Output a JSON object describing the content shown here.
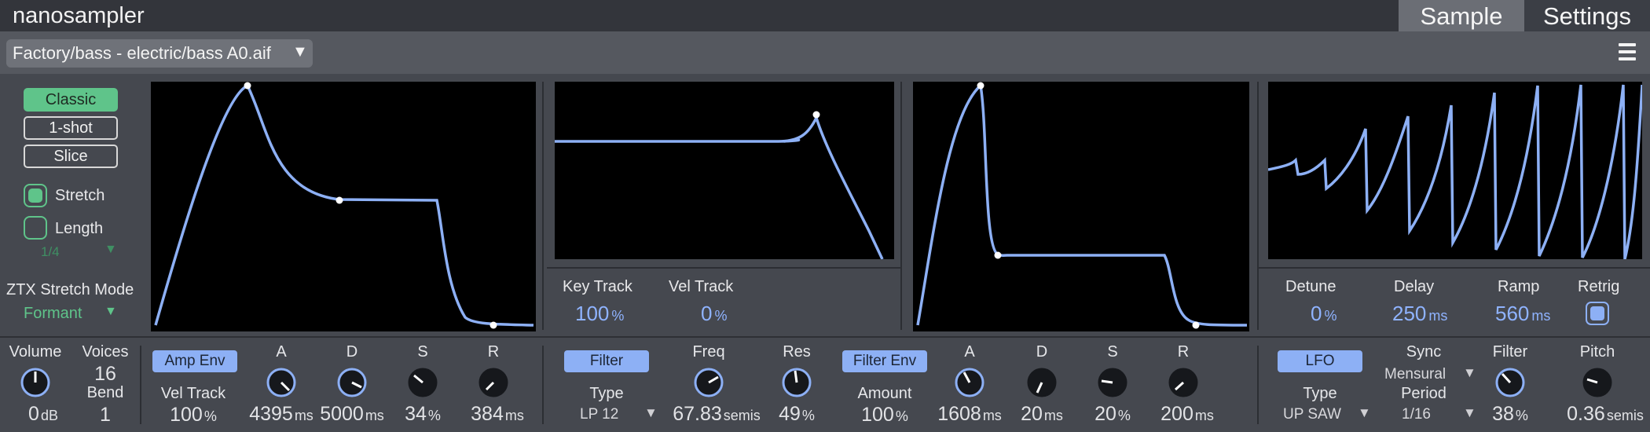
{
  "app_title": "nanosampler",
  "tabs": {
    "sample": "Sample",
    "settings": "Settings"
  },
  "file": {
    "path": "Factory/bass - electric/bass A0.aif",
    "arrow": "▼"
  },
  "colors": {
    "accent_green": "#5fc48a",
    "curve_blue": "#8db0f5",
    "value_blue": "#8fb3ff",
    "plot_bg": "#000000"
  },
  "left_panel": {
    "modes": [
      "Classic",
      "1-shot",
      "Slice"
    ],
    "active_mode": "Classic",
    "stretch_label": "Stretch",
    "stretch_checked": true,
    "length_label": "Length",
    "length_checked": false,
    "length_value": "1/4",
    "ztx_label": "ZTX Stretch Mode",
    "ztx_value": "Formant",
    "dropdown_icon": "triangle-down-icon"
  },
  "filter_panel": {
    "key_track_label": "Key Track",
    "key_track_value": "100",
    "key_track_unit": "%",
    "vel_track_label": "Vel Track",
    "vel_track_value": "0",
    "vel_track_unit": "%"
  },
  "lfo_panel": {
    "detune_label": "Detune",
    "detune_value": "0",
    "detune_unit": "%",
    "delay_label": "Delay",
    "delay_value": "250",
    "delay_unit": "ms",
    "ramp_label": "Ramp",
    "ramp_value": "560",
    "ramp_unit": "ms",
    "retrig_label": "Retrig",
    "retrig_checked": true
  },
  "bottom": {
    "volume_label": "Volume",
    "volume_value": "0",
    "volume_unit": "dB",
    "voices_label": "Voices",
    "voices_value": "16",
    "bend_label": "Bend",
    "bend_value": "1",
    "amp_env_label": "Amp Env",
    "vel_track_label": "Vel Track",
    "vel_track_value": "100",
    "vel_track_unit": "%",
    "amp": {
      "a_label": "A",
      "a_value": "4395",
      "a_unit": "ms",
      "d_label": "D",
      "d_value": "5000",
      "d_unit": "ms",
      "s_label": "S",
      "s_value": "34",
      "s_unit": "%",
      "r_label": "R",
      "r_value": "384",
      "r_unit": "ms"
    },
    "filter_label": "Filter",
    "type_label": "Type",
    "filter_type": "LP 12",
    "freq_label": "Freq",
    "freq_value": "67.83",
    "freq_unit": "semis",
    "res_label": "Res",
    "res_value": "49",
    "res_unit": "%",
    "filter_env_label": "Filter Env",
    "amount_label": "Amount",
    "amount_value": "100",
    "amount_unit": "%",
    "fenv": {
      "a_label": "A",
      "a_value": "1608",
      "a_unit": "ms",
      "d_label": "D",
      "d_value": "20",
      "d_unit": "ms",
      "s_label": "S",
      "s_value": "20",
      "s_unit": "%",
      "r_label": "R",
      "r_value": "200",
      "r_unit": "ms"
    },
    "lfo_label": "LFO",
    "lfo_type_label": "Type",
    "lfo_type": "UP SAW",
    "sync_label": "Sync",
    "sync_value": "Mensural",
    "period_label": "Period",
    "period_value": "1/16",
    "lfo_filter_label": "Filter",
    "lfo_filter_value": "38",
    "lfo_filter_unit": "%",
    "pitch_label": "Pitch",
    "pitch_value": "0.36",
    "pitch_unit": "semis"
  }
}
